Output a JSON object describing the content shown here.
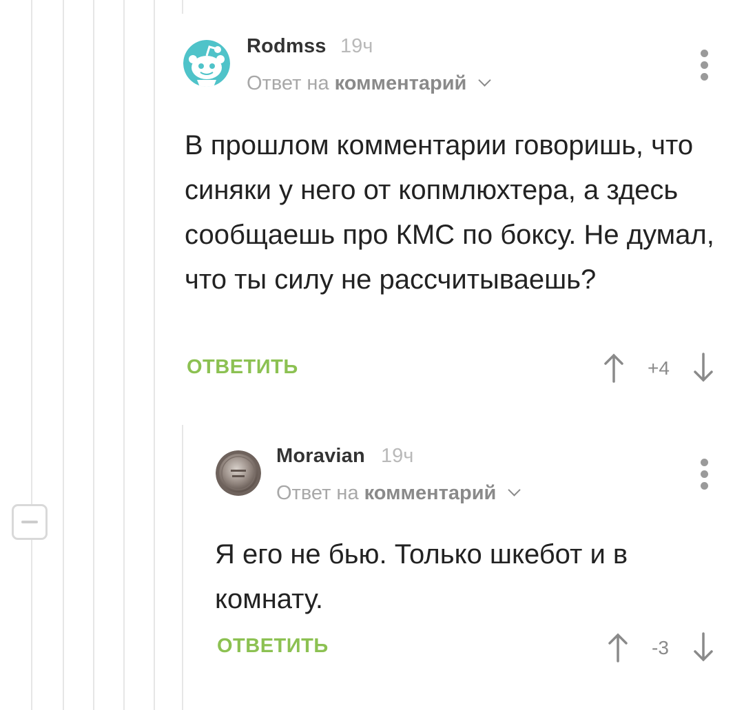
{
  "comments": [
    {
      "username": "Rodmss",
      "time": "19ч",
      "reply_prefix": "Ответ на",
      "reply_link": "комментарий",
      "text": "В прошлом комментарии говоришь, что синяки у него от копмлюхтера, а здесь сообщаешь про КМС по боксу. Не думал, что ты силу не рассчитываешь?",
      "reply_label": "ОТВЕТИТЬ",
      "score": "+4",
      "avatar_icon": "reddit-alien-avatar"
    },
    {
      "username": "Moravian",
      "time": "19ч",
      "reply_prefix": "Ответ на",
      "reply_link": "комментарий",
      "text": "Я его не бью. Только шкебот и в комнату.",
      "reply_label": "ОТВЕТИТЬ",
      "score": "-3",
      "avatar_icon": "coin-avatar"
    }
  ],
  "icons": {
    "upvote": "arrow-up-icon",
    "downvote": "arrow-down-icon",
    "menu": "more-vertical-icon",
    "collapse": "minus-icon",
    "expand": "chevron-down-icon"
  },
  "colors": {
    "accent_green": "#8cc152",
    "thread_line": "#e6e6e6",
    "muted_text": "#a8a8a8"
  }
}
